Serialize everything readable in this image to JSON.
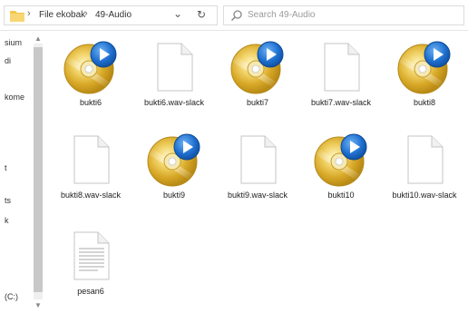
{
  "address": {
    "crumbs": [
      "File ekobak",
      "49-Audio"
    ],
    "separator": "›"
  },
  "search": {
    "placeholder": "Search 49-Audio"
  },
  "nav": {
    "items": [
      "sium",
      "di",
      "kome",
      "t",
      "ts",
      "k",
      "(C:)"
    ]
  },
  "files": [
    {
      "name": "bukti6",
      "type": "audio"
    },
    {
      "name": "bukti6.wav-slack",
      "type": "blank"
    },
    {
      "name": "bukti7",
      "type": "audio"
    },
    {
      "name": "bukti7.wav-slack",
      "type": "blank"
    },
    {
      "name": "bukti8",
      "type": "audio"
    },
    {
      "name": "bukti8.wav-slack",
      "type": "blank"
    },
    {
      "name": "bukti9",
      "type": "audio"
    },
    {
      "name": "bukti9.wav-slack",
      "type": "blank"
    },
    {
      "name": "bukti10",
      "type": "audio"
    },
    {
      "name": "bukti10.wav-slack",
      "type": "blank"
    },
    {
      "name": "pesan6",
      "type": "text"
    }
  ],
  "colors": {
    "accent": "#1e6fd0",
    "disc_gold": "#e8c04a",
    "folder": "#f2c84b"
  }
}
